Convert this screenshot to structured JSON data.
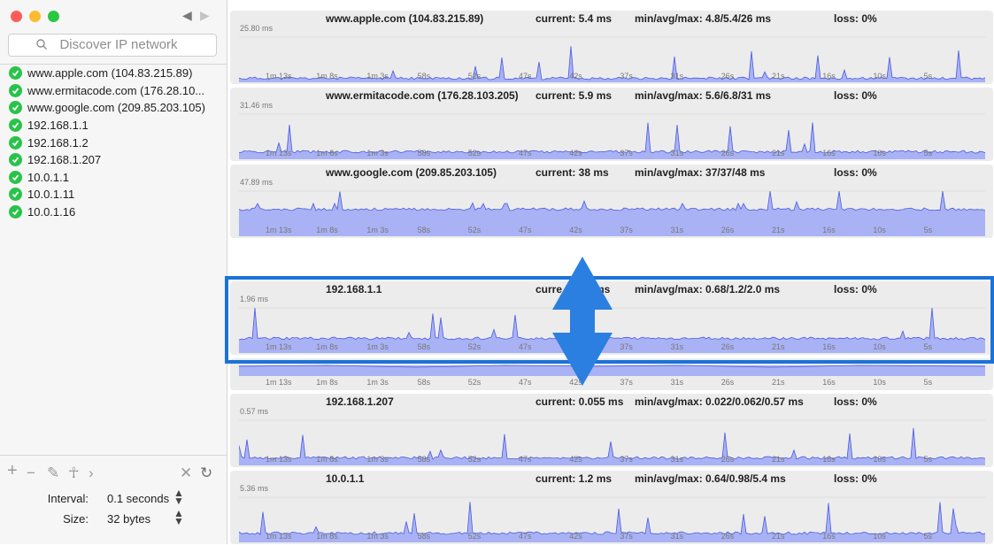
{
  "search": {
    "placeholder": "Discover IP network"
  },
  "sidebar": {
    "hosts": [
      "www.apple.com (104.83.215.89)",
      "www.ermitacode.com (176.28.10...",
      "www.google.com (209.85.203.105)",
      "192.168.1.1",
      "192.168.1.2",
      "192.168.1.207",
      "10.0.1.1",
      "10.0.1.11",
      "10.0.1.16"
    ],
    "status_icon": "check-circle-icon",
    "status_color": "#29c34a"
  },
  "toolbar": {
    "icons": [
      "plus-icon",
      "minus-icon",
      "pencil-icon",
      "person-icon",
      "chevron-right-icon",
      "close-icon",
      "refresh-icon"
    ]
  },
  "settings": {
    "interval_label": "Interval:",
    "interval_value": "0.1 seconds",
    "size_label": "Size:",
    "size_value": "32 bytes"
  },
  "time_ticks": [
    "1m 13s",
    "1m 8s",
    "1m 3s",
    "58s",
    "52s",
    "47s",
    "42s",
    "37s",
    "31s",
    "26s",
    "21s",
    "16s",
    "10s",
    "5s"
  ],
  "graph_color": "#a9b2f4",
  "line_color": "#4b5be0",
  "panels": [
    {
      "host": "www.apple.com (104.83.215.89)",
      "current": "current: 5.4 ms",
      "minavgmax": "min/avg/max: 4.8/5.4/26 ms",
      "loss": "loss: 0%",
      "scale": "25.80 ms"
    },
    {
      "host": "www.ermitacode.com (176.28.103.205)",
      "current": "current: 5.9 ms",
      "minavgmax": "min/avg/max: 5.6/6.8/31 ms",
      "loss": "loss: 0%",
      "scale": "31.46 ms"
    },
    {
      "host": "www.google.com (209.85.203.105)",
      "current": "current: 38 ms",
      "minavgmax": "min/avg/max: 37/37/48 ms",
      "loss": "loss: 0%",
      "scale": "47.89 ms"
    },
    {
      "host": "192.168.1.1",
      "current": "curre",
      "current_tail": "ms",
      "minavgmax": "min/avg/max: 0.68/1.2/2.0 ms",
      "loss": "loss: 0%",
      "scale": "1.96 ms"
    },
    {
      "host": "192.168.1.207",
      "current": "current: 0.055 ms",
      "minavgmax": "min/avg/max: 0.022/0.062/0.57 ms",
      "loss": "loss: 0%",
      "scale": "0.57 ms"
    },
    {
      "host": "10.0.1.1",
      "current": "current: 1.2 ms",
      "minavgmax": "min/avg/max: 0.64/0.98/5.4 ms",
      "loss": "loss: 0%",
      "scale": "5.36 ms"
    }
  ],
  "overlay": {
    "arrow_icon": "reorder-arrows-icon",
    "highlight_color": "#1a73d9"
  }
}
